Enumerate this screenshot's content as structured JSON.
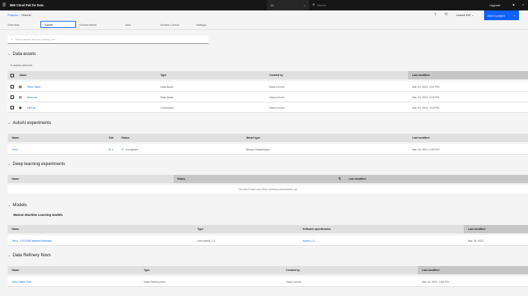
{
  "topbar": {
    "brand": "IBM Cloud Pak for Data",
    "scope": "All",
    "search_placeholder": "Search",
    "upgrade": "Upgrade"
  },
  "breadcrumb": {
    "projects": "Projects",
    "separator": "/",
    "current": "Telco AI"
  },
  "header": {
    "launch_ide": "Launch IDE",
    "add_to_project": "Add to project"
  },
  "tabs": [
    "Overview",
    "Assets",
    "Environments",
    "Jobs",
    "Access Control",
    "Settings"
  ],
  "search": {
    "placeholder": "What assets are you looking for?"
  },
  "data_assets": {
    "title": "Data assets",
    "selected": "0 assets selected.",
    "columns": [
      "Name",
      "Type",
      "Created by",
      "Last modified"
    ],
    "rows": [
      {
        "icon": "table-icon",
        "name": "Telco-Table",
        "type": "Data Asset",
        "created_by": "Dana Lenner",
        "modified": "Mar 24, 2021, 3:21 PM"
      },
      {
        "icon": "csv-file-icon",
        "name": "telco.csv",
        "type": "Data Asset",
        "created_by": "Dana Lenner",
        "modified": "Mar 24, 2021, 3:18 PM"
      },
      {
        "icon": "database-connection-icon",
        "name": "Db2-cp",
        "type": "Connection",
        "created_by": "Dana Lenner",
        "modified": "Mar 24, 2021, 3:18 PM"
      }
    ]
  },
  "autoai": {
    "title": "AutoAI experiments",
    "columns": [
      "Name",
      "Site",
      "Status",
      "Model type",
      "Last modified"
    ],
    "rows": [
      {
        "name": "Telco",
        "site": "1",
        "status": "Completed",
        "model_type": "Binary Classification",
        "modified": "Mar 26, 2021, 5:32 PM"
      }
    ]
  },
  "deep_learning": {
    "title": "Deep learning experiments",
    "columns": [
      "Name",
      "Status",
      "Last modified"
    ],
    "empty": "You don't have any Deep learning experiments yet"
  },
  "models": {
    "title": "Models",
    "subtitle": "Watson Machine Learning models",
    "columns": [
      "Name",
      "Type",
      "Software specification",
      "Last modified"
    ],
    "rows": [
      {
        "name": "Telco - P4 XGBClassifierEstimator",
        "type": "wml-hybrid_0.1",
        "spec": "hybrid_0.1",
        "modified": "Mar 26, 2021"
      }
    ]
  },
  "refinery": {
    "title": "Data Refinery flows",
    "columns": [
      "Name",
      "Type",
      "Created by",
      "Last modified"
    ],
    "rows": [
      {
        "name": "Telco-Table_flow",
        "type": "Data Refinery flow",
        "created_by": "Dana Lenner",
        "modified": "Mar 24, 2021, 3:53 PM"
      }
    ]
  }
}
